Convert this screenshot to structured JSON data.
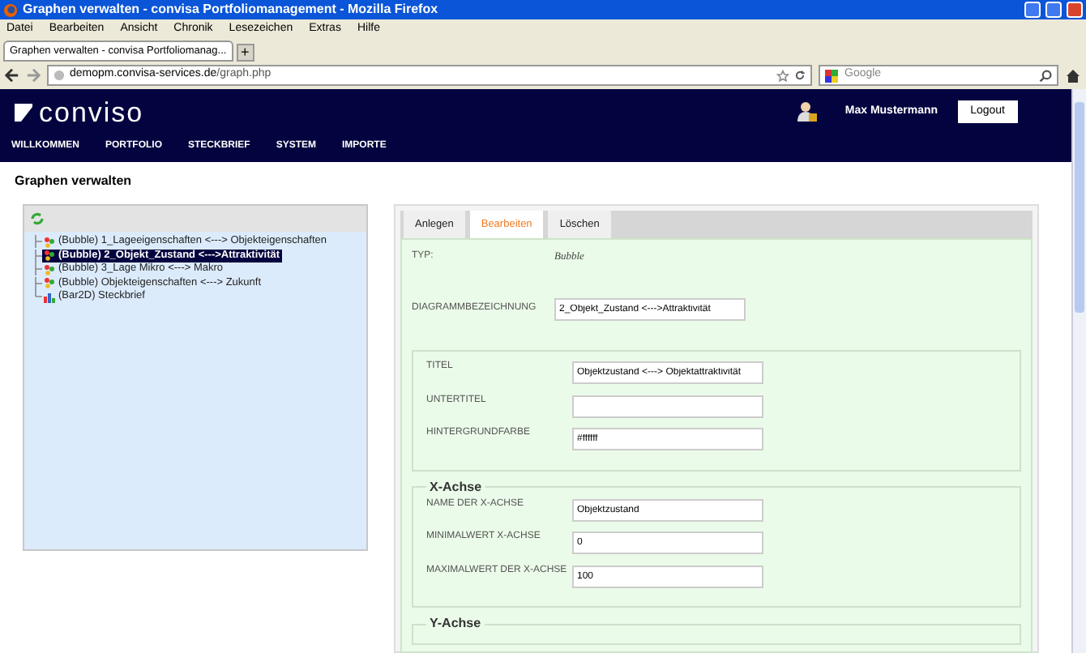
{
  "browser": {
    "title": "Graphen verwalten - convisa Portfoliomanagement - Mozilla Firefox",
    "menu": [
      "Datei",
      "Bearbeiten",
      "Ansicht",
      "Chronik",
      "Lesezeichen",
      "Extras",
      "Hilfe"
    ],
    "tab_title": "Graphen verwalten - convisa Portfoliomanag...",
    "new_tab": "+",
    "url_host": "demopm.convisa-services.de",
    "url_path": "/graph.php",
    "search_placeholder": "Google"
  },
  "app": {
    "logo": "conviso",
    "user": "Max Mustermann",
    "logout": "Logout",
    "nav": [
      "WILLKOMMEN",
      "PORTFOLIO",
      "STECKBRIEF",
      "SYSTEM",
      "IMPORTE"
    ]
  },
  "page_title": "Graphen verwalten",
  "tree": [
    {
      "kind": "bubble",
      "label": "(Bubble) 1_Lageeigenschaften <---> Objekteigenschaften",
      "selected": false
    },
    {
      "kind": "bubble",
      "label": "(Bubble) 2_Objekt_Zustand <--->Attraktivität",
      "selected": true
    },
    {
      "kind": "bubble",
      "label": "(Bubble) 3_Lage Mikro <---> Makro",
      "selected": false
    },
    {
      "kind": "bubble",
      "label": "(Bubble) Objekteigenschaften <---> Zukunft",
      "selected": false
    },
    {
      "kind": "bar",
      "label": "(Bar2D) Steckbrief",
      "selected": false
    }
  ],
  "tabs": [
    {
      "label": "Anlegen",
      "selected": false
    },
    {
      "label": "Bearbeiten",
      "selected": true
    },
    {
      "label": "Löschen",
      "selected": false
    }
  ],
  "form": {
    "typ_label": "TYP:",
    "typ_value": "Bubble",
    "name_label": "DIAGRAMMBEZEICHNUNG",
    "name_value": "2_Objekt_Zustand <--->Attraktivität",
    "fieldsets": [
      {
        "fields": [
          {
            "label": "TITEL",
            "value": "Objektzustand <---> Objektattraktivität"
          },
          {
            "label": "UNTERTITEL"
          },
          {
            "label": "HINTERGRUNDFARBE",
            "value": "#ffffff"
          }
        ]
      },
      {
        "legend": "X-Achse",
        "fields": [
          {
            "label": "NAME DER X-ACHSE",
            "value": "Objektzustand"
          },
          {
            "label": "MINIMALWERT X-ACHSE",
            "value": "0"
          },
          {
            "label": "MAXIMALWERT DER X-ACHSE",
            "value": "100"
          }
        ]
      },
      {
        "legend": "Y-Achse"
      }
    ]
  }
}
